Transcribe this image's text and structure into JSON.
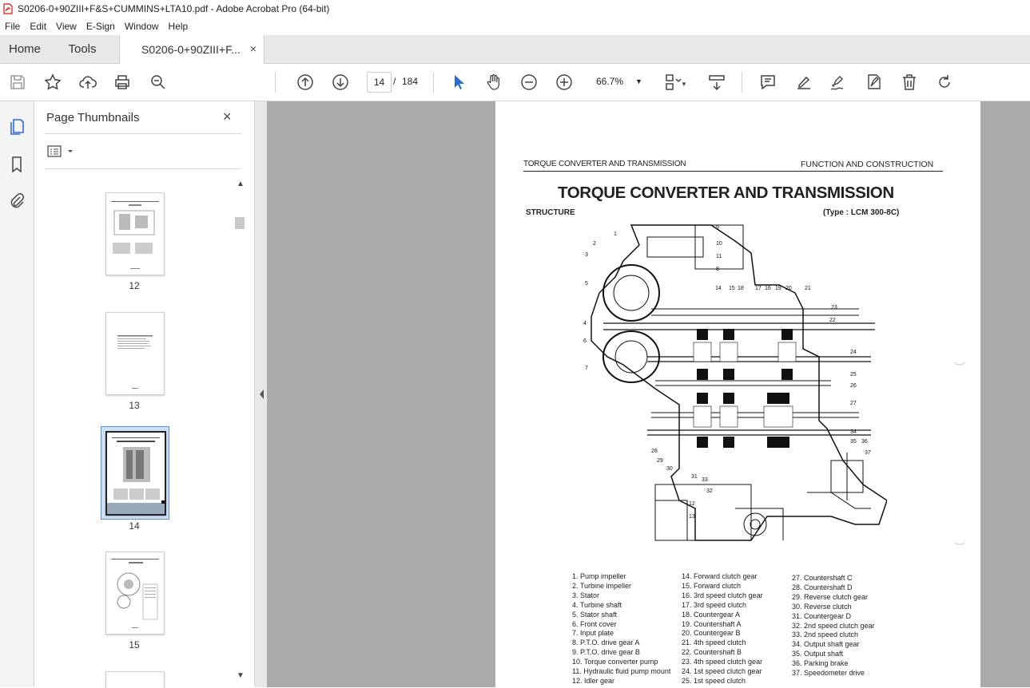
{
  "window": {
    "title": "S0206-0+90ZIII+F&S+CUMMINS+LTA10.pdf - Adobe Acrobat Pro (64-bit)"
  },
  "menu": [
    "File",
    "Edit",
    "View",
    "E-Sign",
    "Window",
    "Help"
  ],
  "tabs": {
    "home": "Home",
    "tools": "Tools",
    "doc": "S0206-0+90ZIII+F...",
    "close": "×"
  },
  "toolbar": {
    "page_current": "14",
    "page_sep": "/",
    "page_total": "184",
    "zoom": "66.7%",
    "icons": [
      "save-icon",
      "star-icon",
      "upload-icon",
      "print-icon",
      "search-icon",
      "page-up-icon",
      "page-down-icon",
      "select-cursor-icon",
      "hand-icon",
      "zoom-out-icon",
      "zoom-in-icon",
      "fit-page-icon",
      "scroll-mode-icon",
      "comment-icon",
      "highlight-icon",
      "sign-icon",
      "fill-sign-icon",
      "delete-icon",
      "rotate-icon"
    ]
  },
  "panel": {
    "title": "Page Thumbnails",
    "close": "×",
    "thumbnails": [
      {
        "label": "12",
        "selected": false
      },
      {
        "label": "13",
        "selected": false
      },
      {
        "label": "14",
        "selected": true
      },
      {
        "label": "15",
        "selected": false
      }
    ]
  },
  "doc": {
    "header_left": "TORQUE CONVERTER AND TRANSMISSION",
    "header_right": "FUNCTION AND CONSTRUCTION",
    "title": "TORQUE CONVERTER AND TRANSMISSION",
    "structure": "STRUCTURE",
    "type": "(Type : LCM 300-8C)",
    "diagram_numbers": [
      "1",
      "2",
      "3",
      "4",
      "5",
      "6",
      "7",
      "8",
      "9",
      "10",
      "11",
      "12",
      "13",
      "14",
      "15",
      "16",
      "17",
      "18",
      "19",
      "20",
      "21",
      "22",
      "23",
      "24",
      "25",
      "26",
      "27",
      "28",
      "29",
      "30",
      "31",
      "32",
      "33",
      "34",
      "35",
      "36",
      "37"
    ],
    "legend_col1": [
      "1. Pump impeller",
      "2. Turbine impeller",
      "3. Stator",
      "4. Turbine shaft",
      "5. Stator shaft",
      "6. Front cover",
      "7. Input plate",
      "8. P.T.O. drive gear A",
      "9. P.T.O. drive gear B",
      "10. Torque converter pump",
      "11. Hydraulic fluid pump mount",
      "12. Idler gear"
    ],
    "legend_col2": [
      "14. Forward clutch gear",
      "15. Forward clutch",
      "16. 3rd speed clutch gear",
      "17. 3rd speed clutch",
      "18. Countergear A",
      "19. Countershaft A",
      "20. Countergear B",
      "21. 4th speed clutch",
      "22. Countershaft B",
      "23. 4th speed clutch gear",
      "24. 1st speed clutch gear",
      "25. 1st speed clutch"
    ],
    "legend_col3": [
      "27. Countershaft C",
      "28. Countershaft D",
      "29. Reverse clutch gear",
      "30. Reverse clutch",
      "31. Countergear D",
      "32. 2nd speed clutch gear",
      "33. 2nd speed clutch",
      "34. Output shaft gear",
      "35. Output shaft",
      "36. Parking brake",
      "37. Speedometer drive"
    ]
  },
  "colors": {
    "accent": "#2b6bd6",
    "viewer_bg": "#aaaaaa",
    "panel_sel": "#cfe0f5"
  }
}
